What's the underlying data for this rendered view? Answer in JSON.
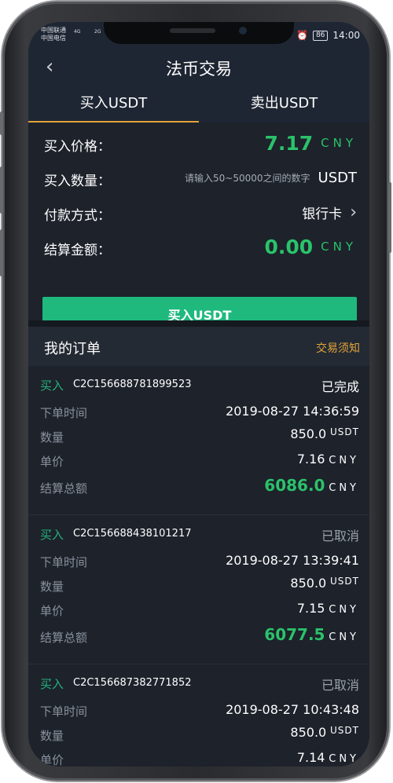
{
  "status_bar": {
    "carrier_1": "中国联通",
    "carrier_2": "中国电信",
    "signal_1": "4G",
    "signal_2": "2G",
    "battery": "86",
    "time": "14:00"
  },
  "nav": {
    "back_icon": "chevron-left",
    "title": "法币交易"
  },
  "tabs": [
    {
      "label": "买入USDT",
      "active": true
    },
    {
      "label": "卖出USDT",
      "active": false
    }
  ],
  "form": {
    "price_label": "买入价格：",
    "price_value": "7.17",
    "price_unit": "CNY",
    "amount_label": "买入数量：",
    "amount_placeholder": "请输入50~50000之间的数字",
    "amount_unit": "USDT",
    "pay_label": "付款方式：",
    "pay_value": "银行卡",
    "total_label": "结算金额：",
    "total_value": "0.00",
    "total_unit": "CNY",
    "buy_button": "买入USDT"
  },
  "orders_header": {
    "title": "我的订单",
    "notice_link": "交易须知"
  },
  "orders": [
    {
      "type": "买入",
      "id": "C2C156688781899523",
      "status": "已完成",
      "time_label": "下单时间",
      "time": "2019-08-27 14:36:59",
      "qty_label": "数量",
      "qty": "850.0",
      "qty_unit": "USDT",
      "price_label": "单价",
      "price": "7.16",
      "price_unit": "CNY",
      "total_label": "结算总额",
      "total": "6086.0",
      "total_unit": "CNY"
    },
    {
      "type": "买入",
      "id": "C2C156688438101217",
      "status": "已取消",
      "time_label": "下单时间",
      "time": "2019-08-27 13:39:41",
      "qty_label": "数量",
      "qty": "850.0",
      "qty_unit": "USDT",
      "price_label": "单价",
      "price": "7.15",
      "price_unit": "CNY",
      "total_label": "结算总额",
      "total": "6077.5",
      "total_unit": "CNY"
    },
    {
      "type": "买入",
      "id": "C2C156687382771852",
      "status": "已取消",
      "time_label": "下单时间",
      "time": "2019-08-27 10:43:48",
      "qty_label": "数量",
      "qty": "850.0",
      "qty_unit": "USDT",
      "price_label": "单价",
      "price": "7.14",
      "price_unit": "CNY"
    }
  ],
  "colors": {
    "accent_green": "#2bc26a",
    "button_green": "#1fb97e",
    "tab_underline": "#e0a43a",
    "background": "#1d222b"
  }
}
